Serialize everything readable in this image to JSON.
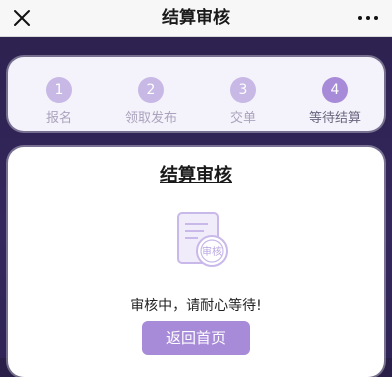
{
  "nav": {
    "title": "结算审核",
    "close_icon": "close-icon",
    "more_icon": "more-icon"
  },
  "steps": [
    {
      "number": "1",
      "label": "报名"
    },
    {
      "number": "2",
      "label": "领取发布"
    },
    {
      "number": "3",
      "label": "交单"
    },
    {
      "number": "4",
      "label": "等待结算"
    }
  ],
  "active_step": 4,
  "card": {
    "title": "结算审核",
    "icon": "review-document-icon",
    "stamp_text": "审核",
    "status": "审核中，请耐心等待!",
    "button_label": "返回首页"
  },
  "colors": {
    "accent": "#a78bd8",
    "step_inactive": "#c7b8e6",
    "background": "#2d2250"
  }
}
